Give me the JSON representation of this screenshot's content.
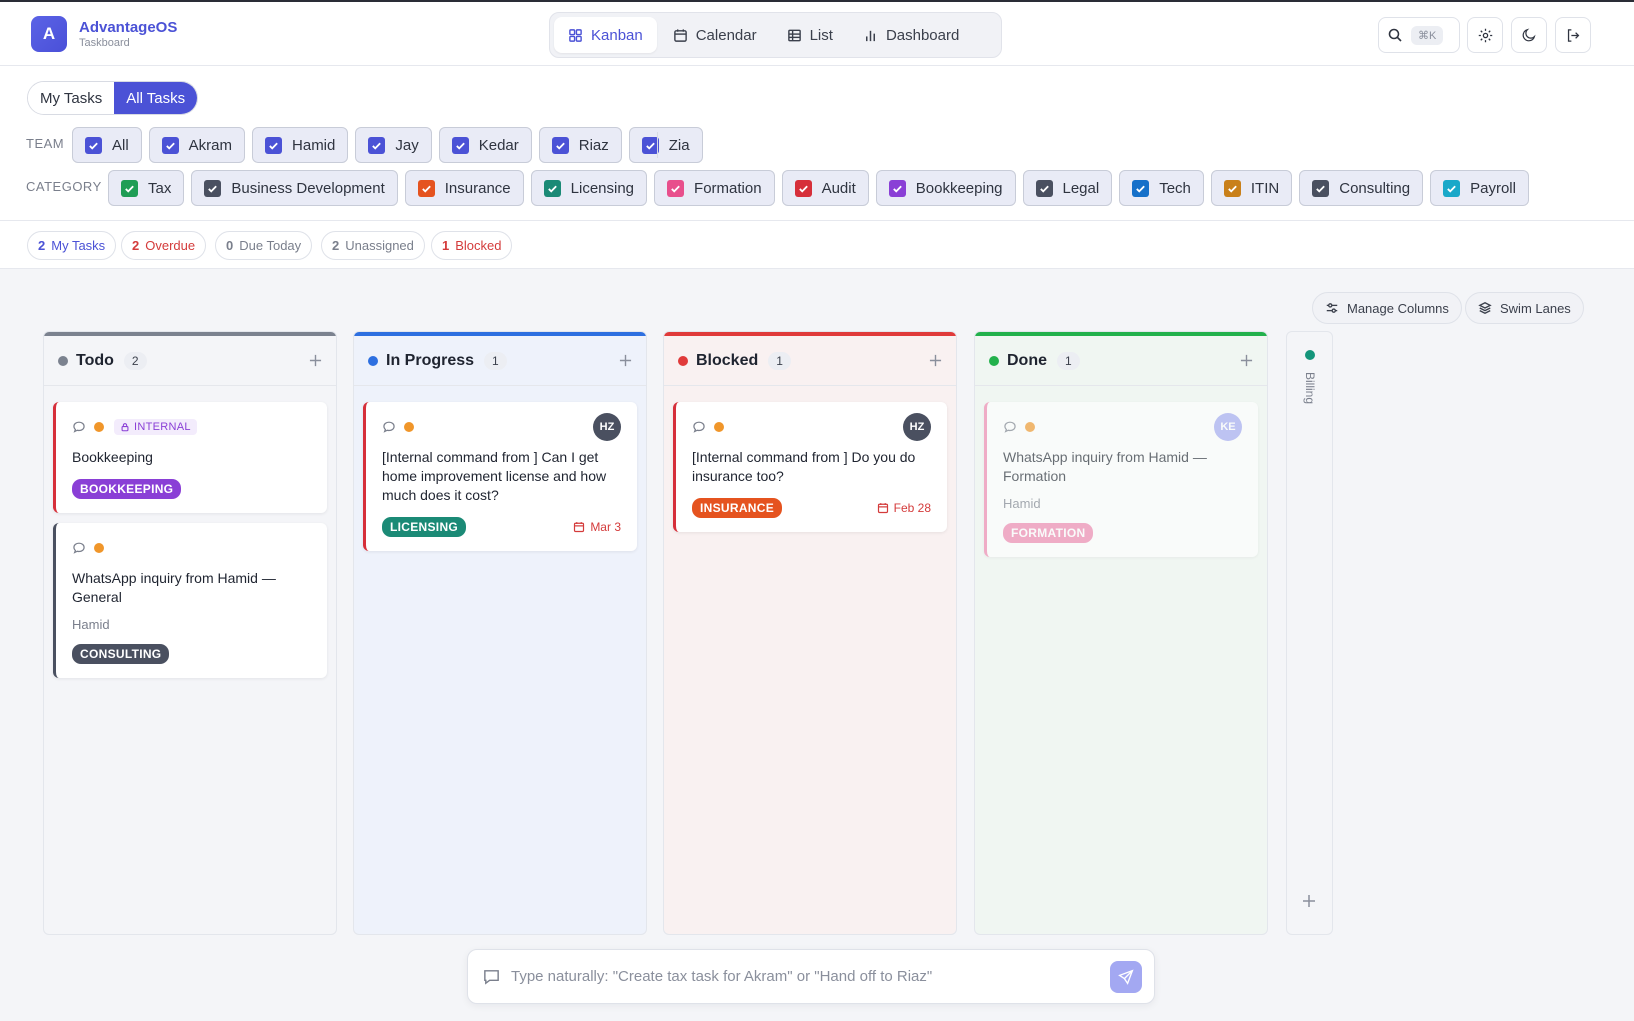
{
  "app": {
    "logo_letter": "A",
    "name": "AdvantageOS",
    "subtitle": "Taskboard"
  },
  "views": [
    {
      "label": "Kanban",
      "icon": "grid-icon",
      "active": true
    },
    {
      "label": "Calendar",
      "icon": "calendar-icon",
      "active": false
    },
    {
      "label": "List",
      "icon": "table-icon",
      "active": false
    },
    {
      "label": "Dashboard",
      "icon": "bar-chart-icon",
      "active": false
    }
  ],
  "header_actions": {
    "search_shortcut": "⌘K"
  },
  "scope": {
    "options": [
      "My Tasks",
      "All Tasks"
    ],
    "selected": "All Tasks"
  },
  "team": {
    "label": "TEAM",
    "chips": [
      {
        "label": "All",
        "checked": true,
        "color": "#4b52d6"
      },
      {
        "label": "Akram",
        "checked": true,
        "color": "#4b52d6"
      },
      {
        "label": "Hamid",
        "checked": true,
        "color": "#4b52d6"
      },
      {
        "label": "Jay",
        "checked": true,
        "color": "#4b52d6"
      },
      {
        "label": "Kedar",
        "checked": true,
        "color": "#4b52d6"
      },
      {
        "label": "Riaz",
        "checked": true,
        "color": "#4b52d6"
      },
      {
        "label": "Zia",
        "checked": true,
        "color": "#4b52d6"
      }
    ]
  },
  "category": {
    "label": "CATEGORY",
    "chips": [
      {
        "label": "Tax",
        "checked": true,
        "color": "#1f9d55"
      },
      {
        "label": "Business Development",
        "checked": true,
        "color": "#4a5060"
      },
      {
        "label": "Insurance",
        "checked": true,
        "color": "#e5531f"
      },
      {
        "label": "Licensing",
        "checked": true,
        "color": "#1b8a76"
      },
      {
        "label": "Formation",
        "checked": true,
        "color": "#e84f8c"
      },
      {
        "label": "Audit",
        "checked": true,
        "color": "#d62f3a"
      },
      {
        "label": "Bookkeeping",
        "checked": true,
        "color": "#8a3fd6"
      },
      {
        "label": "Legal",
        "checked": true,
        "color": "#4a5060"
      },
      {
        "label": "Tech",
        "checked": true,
        "color": "#1670c9"
      },
      {
        "label": "ITIN",
        "checked": true,
        "color": "#c9801a"
      },
      {
        "label": "Consulting",
        "checked": true,
        "color": "#4a5060"
      },
      {
        "label": "Payroll",
        "checked": true,
        "color": "#1aa8c9"
      }
    ]
  },
  "stats": [
    {
      "count": "2",
      "label": "My Tasks",
      "color": "#4b52d6"
    },
    {
      "count": "2",
      "label": "Overdue",
      "color": "#d43b3b"
    },
    {
      "count": "0",
      "label": "Due Today",
      "color": "#7a7f8c"
    },
    {
      "count": "2",
      "label": "Unassigned",
      "color": "#7a7f8c"
    },
    {
      "count": "1",
      "label": "Blocked",
      "color": "#d43b3b"
    }
  ],
  "board_controls": {
    "manage_columns": "Manage Columns",
    "swim_lanes": "Swim Lanes"
  },
  "columns": [
    {
      "title": "Todo",
      "count": "2",
      "accent": "#7b828f",
      "bg": "#f4f5f8",
      "cards": [
        {
          "badge": "INTERNAL",
          "title": "Bookkeeping",
          "assignee": "",
          "tag": "BOOKKEEPING",
          "tag_color": "#8a3fd6",
          "border": "#d62f3a",
          "avatar": "",
          "due": "",
          "faded": false
        },
        {
          "badge": "",
          "title": "WhatsApp inquiry from Hamid — General",
          "assignee": "Hamid",
          "tag": "CONSULTING",
          "tag_color": "#4a5060",
          "border": "#4a5060",
          "avatar": "",
          "due": "",
          "faded": false
        }
      ]
    },
    {
      "title": "In Progress",
      "count": "1",
      "accent": "#2d6fe0",
      "bg": "#eef2fb",
      "cards": [
        {
          "badge": "",
          "title": "[Internal command from ] Can I get home improvement license and how much does it cost?",
          "assignee": "",
          "tag": "LICENSING",
          "tag_color": "#1b8a76",
          "border": "#d62f3a",
          "avatar": "HZ",
          "avatar_color": "#4a5060",
          "due": "Mar 3",
          "faded": false
        }
      ]
    },
    {
      "title": "Blocked",
      "count": "1",
      "accent": "#e03a3a",
      "bg": "#f9f1f1",
      "cards": [
        {
          "badge": "",
          "title": "[Internal command from ] Do you do insurance too?",
          "assignee": "",
          "tag": "INSURANCE",
          "tag_color": "#e5531f",
          "border": "#d62f3a",
          "avatar": "HZ",
          "avatar_color": "#4a5060",
          "due": "Feb 28",
          "faded": false
        }
      ]
    },
    {
      "title": "Done",
      "count": "1",
      "accent": "#22b14c",
      "bg": "#f0f6f2",
      "cards": [
        {
          "badge": "",
          "title": "WhatsApp inquiry from Hamid — Formation",
          "assignee": "Hamid",
          "tag": "FORMATION",
          "tag_color": "#ef86b0",
          "border": "#ef86b0",
          "avatar": "KE",
          "avatar_color": "#a3a8f2",
          "due": "",
          "faded": true
        }
      ]
    }
  ],
  "collapsed_column": {
    "label": "Billing"
  },
  "command": {
    "placeholder": "Type naturally: \"Create tax task for Akram\" or \"Hand off to Riaz\""
  }
}
